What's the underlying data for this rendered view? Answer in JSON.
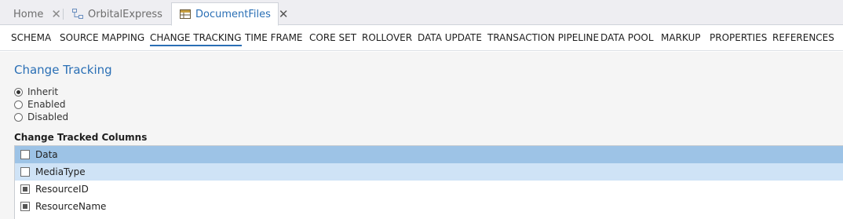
{
  "document_tabs": [
    {
      "label": "Home",
      "icon": "home-tab",
      "active": false
    },
    {
      "label": "OrbitalExpress",
      "icon": "schema-diagram-icon",
      "active": false
    },
    {
      "label": "DocumentFiles",
      "icon": "table-icon",
      "active": true
    }
  ],
  "close_glyph": "✕",
  "subnav": [
    "SCHEMA",
    "SOURCE MAPPING",
    "CHANGE TRACKING",
    "TIME FRAME",
    "CORE SET",
    "ROLLOVER",
    "DATA UPDATE",
    "TRANSACTION PIPELINE",
    "DATA POOL",
    "MARKUP",
    "PROPERTIES",
    "REFERENCES"
  ],
  "subnav_active": "CHANGE TRACKING",
  "section_title": "Change Tracking",
  "tracking_options": [
    {
      "label": "Inherit",
      "checked": true
    },
    {
      "label": "Enabled",
      "checked": false
    },
    {
      "label": "Disabled",
      "checked": false
    }
  ],
  "columns_heading": "Change Tracked Columns",
  "columns": [
    {
      "name": "Data",
      "state": "unchecked",
      "row_style": "selected"
    },
    {
      "name": "MediaType",
      "state": "unchecked",
      "row_style": "hover"
    },
    {
      "name": "ResourceID",
      "state": "indeterminate",
      "row_style": "normal"
    },
    {
      "name": "ResourceName",
      "state": "indeterminate",
      "row_style": "normal"
    }
  ],
  "colors": {
    "accent": "#2a6fb5",
    "selected_row": "#9dc3e6",
    "hover_row": "#cfe3f6"
  }
}
